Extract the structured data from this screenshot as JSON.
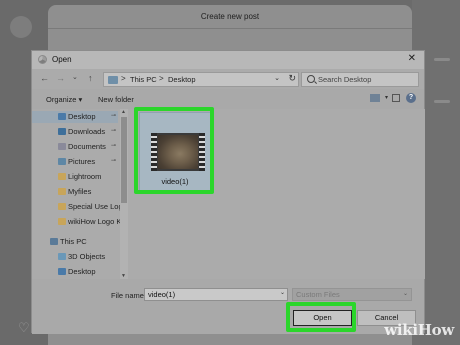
{
  "background": {
    "post_modal_title": "Create new post"
  },
  "dialog": {
    "title": "Open",
    "close_glyph": "✕",
    "nav": {
      "back_glyph": "←",
      "forward_glyph": "→",
      "recent_glyph": "⌄",
      "up_glyph": "↑",
      "breadcrumb": [
        "This PC",
        "Desktop"
      ],
      "separator": ">",
      "dropdown_glyph": "⌄",
      "refresh_glyph": "↻",
      "search_placeholder": "Search Desktop"
    },
    "commands": {
      "organize": "Organize ▾",
      "new_folder": "New folder",
      "view_drop_glyph": "▾",
      "help_glyph": "?"
    },
    "sidebar": {
      "items": [
        {
          "label": "Desktop",
          "icon": "desktop-icon",
          "pinned": true,
          "selected": true
        },
        {
          "label": "Downloads",
          "icon": "download-folder-icon",
          "pinned": true
        },
        {
          "label": "Documents",
          "icon": "documents-folder-icon",
          "pinned": true
        },
        {
          "label": "Pictures",
          "icon": "pictures-folder-icon",
          "pinned": true
        },
        {
          "label": "Lightroom",
          "icon": "folder-icon",
          "pinned": false
        },
        {
          "label": "Myfiles",
          "icon": "folder-icon",
          "pinned": false
        },
        {
          "label": "Special Use Logo",
          "icon": "folder-icon",
          "pinned": false
        },
        {
          "label": "wikiHow Logo Ki",
          "icon": "folder-icon",
          "pinned": false
        },
        {
          "label": "This PC",
          "icon": "computer-icon",
          "pinned": false
        },
        {
          "label": "3D Objects",
          "icon": "3d-objects-icon",
          "pinned": false
        },
        {
          "label": "Desktop",
          "icon": "desktop-icon",
          "pinned": false
        }
      ],
      "pin_glyph": "📌",
      "scroll_up_glyph": "▲",
      "scroll_down_glyph": "▼"
    },
    "files": [
      {
        "name": "video(1)",
        "type": "video",
        "icon": "video-file-icon"
      }
    ],
    "bottom": {
      "file_name_label": "File name:",
      "file_name_value": "video(1)",
      "filter_value": "Custom Files",
      "drop_glyph": "⌄",
      "open_label": "Open",
      "cancel_label": "Cancel"
    }
  },
  "highlight_color": "#2bd62b",
  "watermark": "wikiHow"
}
